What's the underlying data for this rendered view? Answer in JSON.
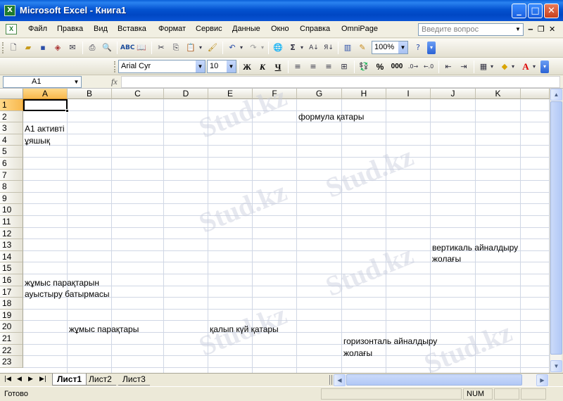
{
  "window": {
    "title": "Microsoft Excel - Книга1"
  },
  "menu": {
    "items": [
      "Файл",
      "Правка",
      "Вид",
      "Вставка",
      "Формат",
      "Сервис",
      "Данные",
      "Окно",
      "Справка",
      "OmniPage"
    ],
    "help_placeholder": "Введите вопрос"
  },
  "toolbar": {
    "zoom": "100%",
    "font_name": "Arial Cyr",
    "font_size": "10",
    "bold": "Ж",
    "italic": "К",
    "underline": "Ч",
    "percent": "%",
    "thousands": "000"
  },
  "formula_bar": {
    "name_box": "A1",
    "fx": "fx"
  },
  "grid": {
    "columns": [
      "A",
      "B",
      "C",
      "D",
      "E",
      "F",
      "G",
      "H",
      "I",
      "J",
      "K",
      ""
    ],
    "rows": [
      "1",
      "2",
      "3",
      "4",
      "5",
      "6",
      "7",
      "8",
      "9",
      "10",
      "11",
      "12",
      "13",
      "14",
      "15",
      "16",
      "17",
      "18",
      "19",
      "20",
      "21",
      "22",
      "23"
    ],
    "active_cell": "A1"
  },
  "annotations": {
    "formula_bar_label": "формула қатары",
    "a1_active_line1": "А1 активті",
    "a1_active_line2": "ұяшық",
    "vertical_scroll_line1": "вертикаль айналдыру",
    "vertical_scroll_line2": "жолағы",
    "sheet_switch_line1": "жұмыс парақтарын",
    "sheet_switch_line2": "ауыстыру батырмасы",
    "worksheets_label": "жұмыс парақтары",
    "status_bar_label": "қалып күй қатары",
    "horizontal_scroll_line1": "горизонталь айналдыру",
    "horizontal_scroll_line2": "жолағы"
  },
  "sheets": [
    "Лист1",
    "Лист2",
    "Лист3"
  ],
  "status": {
    "text": "Готово",
    "num": "NUM"
  },
  "watermark": "Stud.kz"
}
